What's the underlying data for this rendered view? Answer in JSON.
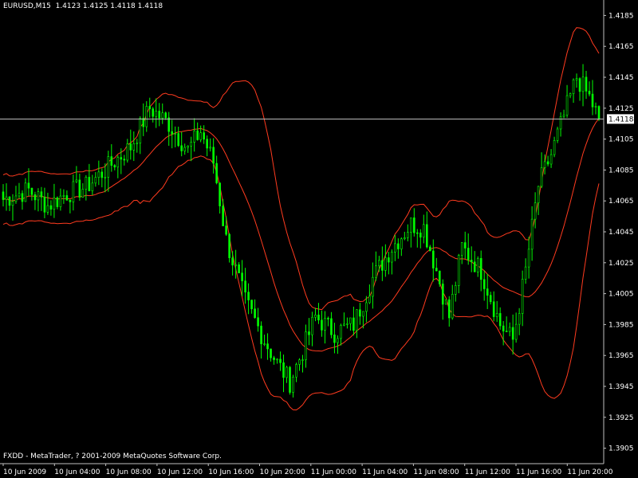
{
  "header": {
    "symbol": "EURUSD,M15",
    "ohlc": "1.4123 1.4125 1.4118 1.4118"
  },
  "footer": {
    "copyright": "FXDD - MetaTrader, ? 2001-2009 MetaQuotes Software Corp."
  },
  "colors": {
    "background": "#000000",
    "candle_up": "#00ff00",
    "bands": "#ff3b1f",
    "price_line": "#c0c0c0",
    "axis": "#c0c0c0"
  },
  "chart_data": {
    "type": "candlestick",
    "title": "EURUSD,M15",
    "grid": false,
    "ylim": [
      1.3895,
      1.4195
    ],
    "y_ticks": [
      "1.4185",
      "1.4165",
      "1.4145",
      "1.4125",
      "1.4105",
      "1.4085",
      "1.4065",
      "1.4045",
      "1.4025",
      "1.4005",
      "1.3985",
      "1.3965",
      "1.3945",
      "1.3925",
      "1.3905"
    ],
    "x_ticks": [
      "10 Jun 2009",
      "10 Jun 04:00",
      "10 Jun 08:00",
      "10 Jun 12:00",
      "10 Jun 16:00",
      "10 Jun 20:00",
      "11 Jun 00:00",
      "11 Jun 04:00",
      "11 Jun 08:00",
      "11 Jun 12:00",
      "11 Jun 16:00",
      "11 Jun 20:00"
    ],
    "current_price": "1.4118",
    "price_keypoints": [
      [
        0,
        1.4066
      ],
      [
        8,
        1.4072
      ],
      [
        14,
        1.4062
      ],
      [
        20,
        1.407
      ],
      [
        26,
        1.4074
      ],
      [
        32,
        1.4085
      ],
      [
        40,
        1.41
      ],
      [
        46,
        1.4125
      ],
      [
        52,
        1.4115
      ],
      [
        58,
        1.4098
      ],
      [
        62,
        1.411
      ],
      [
        66,
        1.409
      ],
      [
        70,
        1.404
      ],
      [
        76,
        1.4
      ],
      [
        82,
        1.3975
      ],
      [
        86,
        1.396
      ],
      [
        90,
        1.3948
      ],
      [
        94,
        1.3968
      ],
      [
        98,
        1.399
      ],
      [
        104,
        1.398
      ],
      [
        110,
        1.3985
      ],
      [
        116,
        1.4015
      ],
      [
        122,
        1.4035
      ],
      [
        128,
        1.405
      ],
      [
        132,
        1.4048
      ],
      [
        136,
        1.402
      ],
      [
        140,
        1.399
      ],
      [
        144,
        1.4035
      ],
      [
        150,
        1.402
      ],
      [
        156,
        1.3985
      ],
      [
        160,
        1.3975
      ],
      [
        164,
        1.402
      ],
      [
        168,
        1.4075
      ],
      [
        172,
        1.4095
      ],
      [
        176,
        1.412
      ],
      [
        180,
        1.4145
      ],
      [
        184,
        1.4132
      ],
      [
        187,
        1.4118
      ]
    ],
    "series": [
      {
        "name": "",
        "role": "upper_band"
      },
      {
        "name": "",
        "role": "middle_band"
      },
      {
        "name": "",
        "role": "lower_band"
      }
    ]
  }
}
